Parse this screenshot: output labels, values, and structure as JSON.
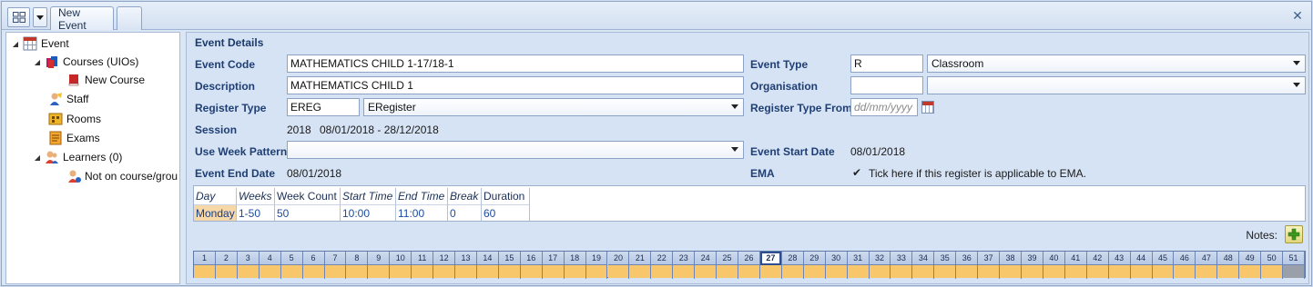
{
  "toolbar": {
    "tab_label": "New Event"
  },
  "tree": {
    "event": "Event",
    "courses": "Courses (UIOs)",
    "new_course": "New Course",
    "staff": "Staff",
    "rooms": "Rooms",
    "exams": "Exams",
    "learners": "Learners (0)",
    "not_on_course": "Not on course/grou"
  },
  "form": {
    "title": "Event Details",
    "event_code_label": "Event Code",
    "event_code": "MATHEMATICS CHILD 1-17/18-1",
    "description_label": "Description",
    "description": "MATHEMATICS CHILD 1",
    "register_type_label": "Register Type",
    "register_type_code": "EREG",
    "register_type_name": "ERegister",
    "session_label": "Session",
    "session_year": "2018",
    "session_range": "08/01/2018 - 28/12/2018",
    "week_pattern_label": "Use Week Pattern",
    "week_pattern": "",
    "event_end_date_label": "Event End Date",
    "event_end_date": "08/01/2018",
    "event_type_label": "Event Type",
    "event_type_code": "R",
    "event_type_name": "Classroom",
    "organisation_label": "Organisation",
    "organisation_code": "",
    "organisation_name": "",
    "register_type_from_label": "Register Type From",
    "register_type_from_placeholder": "dd/mm/yyyy",
    "event_start_date_label": "Event Start Date",
    "event_start_date": "08/01/2018",
    "ema_label": "EMA",
    "ema_checkbox_glyph": "✔",
    "ema_text": "Tick here if this register is applicable to EMA."
  },
  "pattern": {
    "headers": {
      "day": "Day",
      "weeks": "Weeks",
      "week_count": "Week Count",
      "start_time": "Start Time",
      "end_time": "End Time",
      "break": "Break",
      "duration": "Duration"
    },
    "row": {
      "day": "Monday",
      "weeks": "1-50",
      "week_count": "50",
      "start_time": "10:00",
      "end_time": "11:00",
      "break": "0",
      "duration": "60"
    }
  },
  "notes": {
    "label": "Notes:"
  },
  "weeks_strip": {
    "count": 51,
    "current_week": 27,
    "inactive_weeks": [
      51
    ]
  }
}
